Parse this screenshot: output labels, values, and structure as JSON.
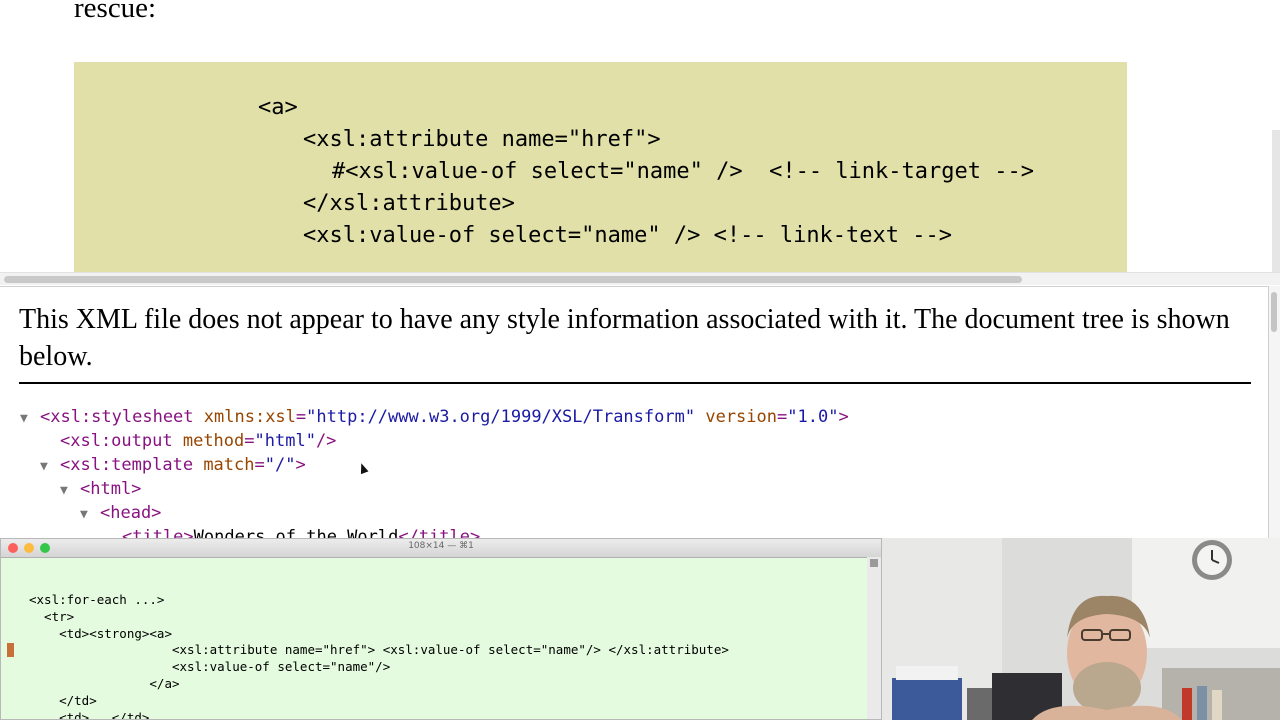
{
  "slide": {
    "intro_text": "rescue:",
    "code_lines": [
      "<a>",
      "<xsl:attribute name=\"href\">",
      "#<xsl:value-of select=\"name\" />  <!-- link-target -->",
      "</xsl:attribute>",
      "<xsl:value-of select=\"name\" /> <!-- link-text -->"
    ],
    "code_bg_color": "#e0e0a8"
  },
  "xml_view": {
    "notice": "This XML file does not appear to have any style information associated with it. The document tree is shown below.",
    "rows": [
      {
        "toggle": "▼",
        "open": "<xsl:stylesheet",
        "attrs": [
          [
            "xmlns:xsl",
            "\"http://www.w3.org/1999/XSL/Transform\""
          ],
          [
            "version",
            "\"1.0\""
          ]
        ],
        "close": ">"
      },
      {
        "toggle": "",
        "open": "<xsl:output",
        "attrs": [
          [
            "method",
            "\"html\""
          ]
        ],
        "close": "/>"
      },
      {
        "toggle": "▼",
        "open": "<xsl:template",
        "attrs": [
          [
            "match",
            "\"/\""
          ]
        ],
        "close": ">"
      },
      {
        "toggle": "▼",
        "open": "<html>",
        "attrs": [],
        "close": ""
      },
      {
        "toggle": "▼",
        "open": "<head>",
        "attrs": [],
        "close": ""
      },
      {
        "toggle": "",
        "open": "<title>",
        "text": "Wonders of the World",
        "end": "</title>"
      }
    ],
    "colors": {
      "tag": "#881280",
      "attr_name": "#994500",
      "attr_value": "#1a1aa6"
    }
  },
  "terminal": {
    "title": "108×14 — ⌘1",
    "lines": [
      "<xsl:for-each ...>",
      "  <tr>",
      "    <td><strong><a>",
      "                   <xsl:attribute name=\"href\"> <xsl:value-of select=\"name\"/> </xsl:attribute>",
      "                   <xsl:value-of select=\"name\"/>",
      "                </a>",
      "    </td>",
      "    <td>...</td>"
    ],
    "bg_color": "#e4fbe0"
  },
  "webcam": {
    "description_icon": "presenter-webcam"
  }
}
